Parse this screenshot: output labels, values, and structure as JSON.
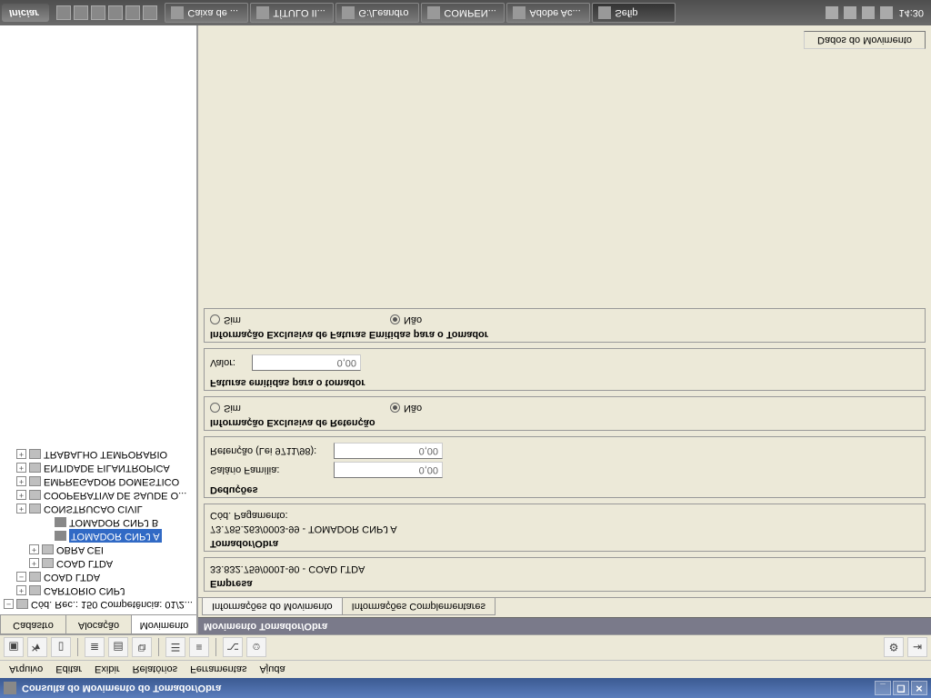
{
  "title": "Consulta do Movimento do Tomador/Obra",
  "menu": {
    "arquivo": "Arquivo",
    "editar": "Editar",
    "exibir": "Exibir",
    "relatorios": "Relatórios",
    "ferramentas": "Ferramentas",
    "ajuda": "Ajuda"
  },
  "side_tabs": {
    "cadastro": "Cadastro",
    "alocacao": "Alocação",
    "movimento": "Movimento"
  },
  "tree": {
    "root": "Cód. Rec.: 150 Competência: 01/2...",
    "cartorio": "CARTORIO CNPJ",
    "coad": "COAD LTDA",
    "coad2": "COAD LTDA",
    "obra": "OBRA CEI",
    "tomadorA": "TOMADOR CNPJ A",
    "tomadorB": "TOMADOR CNPJ B",
    "construcao": "CONSTRUCAO CIVIL",
    "cooperativa": "COOPERATIVA DE SAUDE O...",
    "empregador": "EMPREGADOR DOMESTICO",
    "entidade": "ENTIDADE FILANTROPICA",
    "trabalho": "TRABALHO TEMPORARIO"
  },
  "content": {
    "panel_title": "Movimento Tomador/Obra",
    "tab_info": "Informações do Movimento",
    "tab_compl": "Informações Complementares",
    "empresa": {
      "legend": "Empresa",
      "value": "33.832.759/0001-90 - COAD LTDA"
    },
    "tomador": {
      "legend": "Tomador/Obra",
      "value": "73.785.263/0003-99 - TOMADOR CNPJ A",
      "cod_label": "Cód. Pagamento:",
      "cod_value": ""
    },
    "deducoes": {
      "legend": "Deduções",
      "salario_label": "Salário Família:",
      "salario_val": "0,00",
      "retencao_label": "Retenção (Lei 9711/98):",
      "retencao_val": "0,00"
    },
    "info_ret": {
      "legend": "Informação Exclusiva de Retenção",
      "sim": "Sim",
      "nao": "Não"
    },
    "faturas": {
      "legend": "Faturas emitidas para o tomador",
      "valor_label": "Valor:",
      "valor_val": "0,00"
    },
    "info_fat": {
      "legend": "Informação Exclusiva de Faturas Emitidas para o Tomador",
      "sim": "Sim",
      "nao": "Não"
    },
    "btn": "Dados do Movimento"
  },
  "taskbar": {
    "start": "Iniciar",
    "items": [
      "Caixa de ...",
      "TÍTULO II...",
      "G:/Leandro",
      "COMPEN...",
      "Adobe Ac...",
      "Sefip"
    ],
    "clock": "14:30"
  }
}
